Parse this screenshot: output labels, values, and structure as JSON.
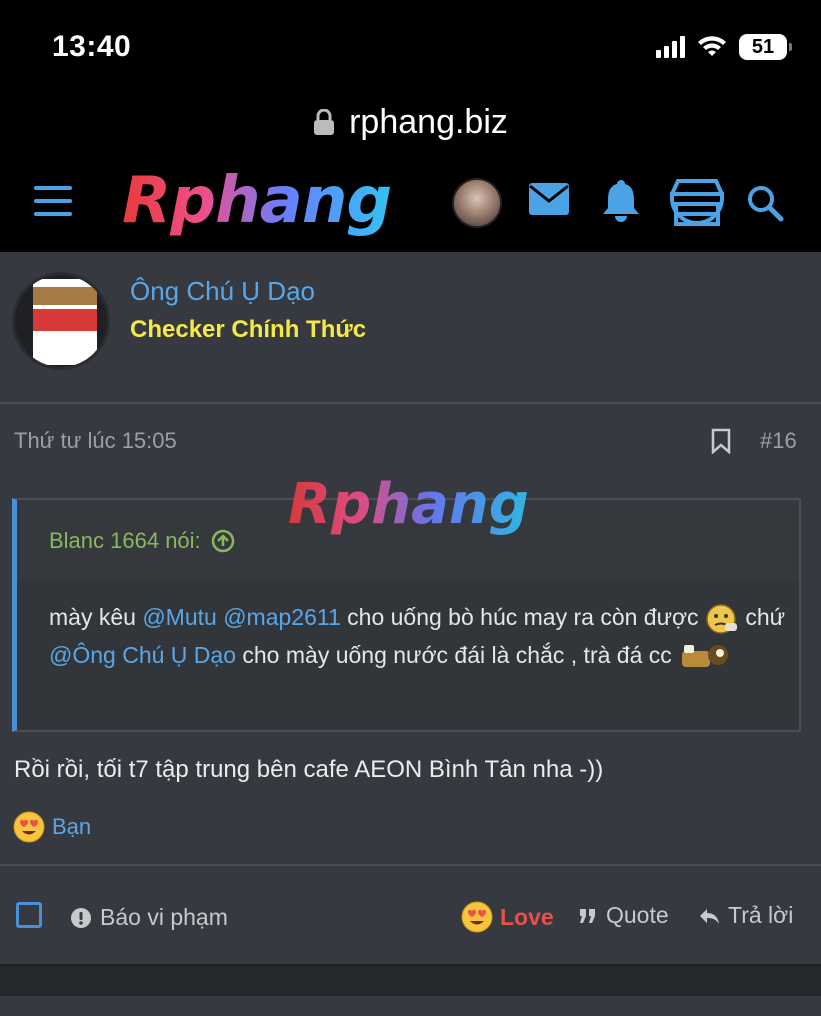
{
  "status_bar": {
    "time": "13:40",
    "battery": "51",
    "icons": [
      "signal-icon",
      "wifi-icon",
      "battery-icon"
    ]
  },
  "url_bar": {
    "domain": "rphang.biz",
    "icon": "lock-icon"
  },
  "header": {
    "logo_text": "Rphang",
    "icons": [
      "menu-icon",
      "avatar",
      "mail-icon",
      "bell-icon",
      "store-icon",
      "search-icon"
    ],
    "accent": "#4ba3e6"
  },
  "author": {
    "name": "Ông Chú Ụ Dạo",
    "title": "Checker Chính Thức"
  },
  "post": {
    "date": "Thứ tư lúc 15:05",
    "number": "#16",
    "watermark": "Rphang",
    "quote": {
      "author_label": "Blanc 1664 nói:",
      "segments": {
        "t1": "mày kêu ",
        "m1": "@Mutu",
        "t2": " ",
        "m2": "@map2611",
        "t3": " cho uống bò húc may ra còn được ",
        "t4": " chứ ",
        "m3": "@Ông Chú Ụ Dạo",
        "t5": " cho mày uống nước đái là chắc , trà đá cc "
      }
    },
    "reply": "Rồi rồi, tối t7 tập trung bên cafe AEON Bình Tân nha -))",
    "reaction": {
      "label": "Bạn",
      "emoji": "heart-eyes-emoji"
    }
  },
  "actions": {
    "report": "Báo vi phạm",
    "love": "Love",
    "quote": "Quote",
    "reply": "Trả lời"
  },
  "colors": {
    "background": "#36393f",
    "link": "#5aa7e8",
    "title_yellow": "#f5e94a",
    "quote_green": "#8ab85a",
    "love_red": "#e8514a"
  }
}
